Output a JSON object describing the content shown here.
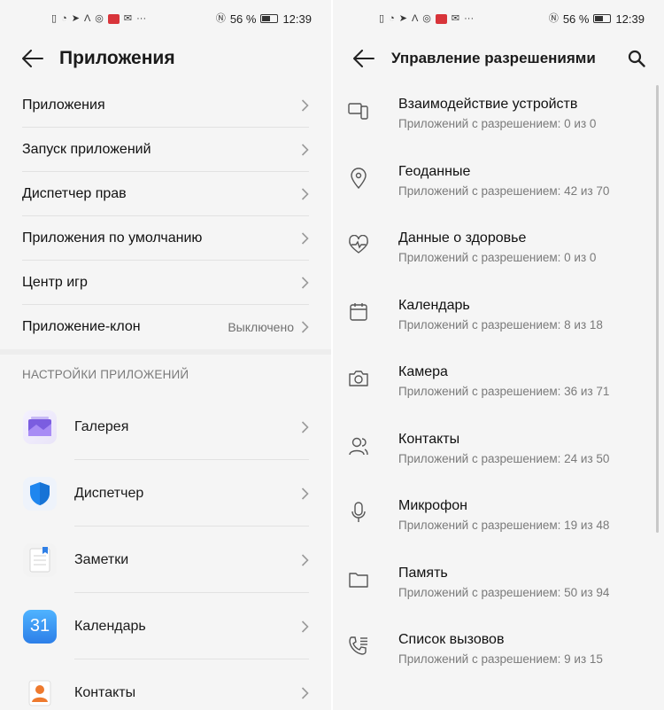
{
  "status_bar": {
    "battery_text": "56 %",
    "time": "12:39"
  },
  "left": {
    "title": "Приложения",
    "menu": [
      {
        "label": "Приложения",
        "value": ""
      },
      {
        "label": "Запуск приложений",
        "value": ""
      },
      {
        "label": "Диспетчер прав",
        "value": ""
      },
      {
        "label": "Приложения по умолчанию",
        "value": ""
      },
      {
        "label": "Центр игр",
        "value": ""
      },
      {
        "label": "Приложение-клон",
        "value": "Выключено"
      }
    ],
    "section_header": "НАСТРОЙКИ ПРИЛОЖЕНИЙ",
    "apps": [
      {
        "name": "Галерея",
        "icon": "gallery-icon"
      },
      {
        "name": "Диспетчер",
        "icon": "shield-icon"
      },
      {
        "name": "Заметки",
        "icon": "notes-icon"
      },
      {
        "name": "Календарь",
        "icon": "calendar-icon",
        "icon_text": "31"
      },
      {
        "name": "Контакты",
        "icon": "contacts-icon"
      }
    ]
  },
  "right": {
    "title": "Управление разрешениями",
    "permissions": [
      {
        "name": "Взаимодействие устройств",
        "count": "Приложений с разрешением: 0 из 0",
        "icon": "devices-icon"
      },
      {
        "name": "Геоданные",
        "count": "Приложений с разрешением: 42 из 70",
        "icon": "location-icon"
      },
      {
        "name": "Данные о здоровье",
        "count": "Приложений с разрешением: 0 из 0",
        "icon": "health-icon"
      },
      {
        "name": "Календарь",
        "count": "Приложений с разрешением: 8 из 18",
        "icon": "calendar-icon"
      },
      {
        "name": "Камера",
        "count": "Приложений с разрешением: 36 из 71",
        "icon": "camera-icon"
      },
      {
        "name": "Контакты",
        "count": "Приложений с разрешением: 24 из 50",
        "icon": "contacts-icon"
      },
      {
        "name": "Микрофон",
        "count": "Приложений с разрешением: 19 из 48",
        "icon": "microphone-icon"
      },
      {
        "name": "Память",
        "count": "Приложений с разрешением: 50 из 94",
        "icon": "folder-icon"
      },
      {
        "name": "Список вызовов",
        "count": "Приложений с разрешением: 9 из 15",
        "icon": "call-log-icon"
      }
    ]
  },
  "colors": {
    "background": "#f5f5f5",
    "divider": "#e2e2e2",
    "secondary_text": "#7a7a7a",
    "accent_blue": "#2d7fe8"
  }
}
